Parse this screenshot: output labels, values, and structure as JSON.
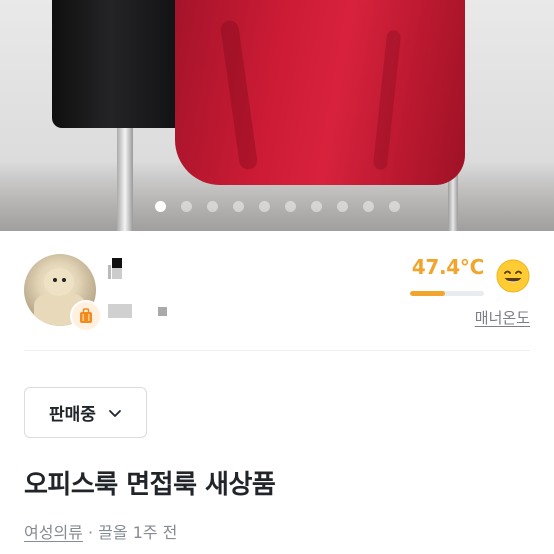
{
  "photo": {
    "slide_count": 10,
    "active_slide": 1
  },
  "seller": {
    "temperature": "47.4°C",
    "temperature_level": 0.474,
    "manner_label": "매너온도",
    "smiley_icon": "smiley-icon",
    "badge_icon": "suitcase-icon"
  },
  "status": {
    "label": "판매중",
    "chevron_icon": "chevron-down-icon"
  },
  "listing": {
    "title": "오피스룩 면접룩 새상품",
    "category": "여성의류",
    "separator": "·",
    "time": "끌올 1주 전"
  },
  "colors": {
    "accent": "#f2a52c",
    "text_primary": "#212529",
    "text_secondary": "#868b94"
  }
}
